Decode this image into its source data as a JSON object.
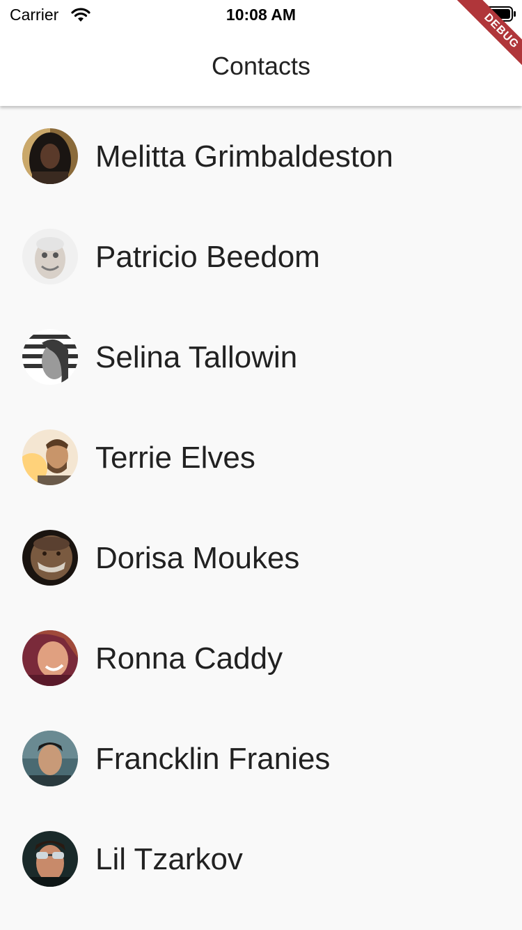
{
  "status_bar": {
    "carrier": "Carrier",
    "time": "10:08 AM",
    "wifi_icon": "wifi-icon",
    "battery_icon": "battery-icon"
  },
  "app_bar": {
    "title": "Contacts"
  },
  "debug_banner": {
    "label": "DEBUG",
    "color": "#b0363a"
  },
  "contacts": [
    {
      "name": "Melitta Grimbaldeston",
      "avatar": "avatar-photo"
    },
    {
      "name": "Patricio Beedom",
      "avatar": "avatar-photo"
    },
    {
      "name": "Selina Tallowin",
      "avatar": "avatar-photo"
    },
    {
      "name": "Terrie Elves",
      "avatar": "avatar-photo"
    },
    {
      "name": "Dorisa Moukes",
      "avatar": "avatar-photo"
    },
    {
      "name": "Ronna Caddy",
      "avatar": "avatar-photo"
    },
    {
      "name": "Francklin Franies",
      "avatar": "avatar-photo"
    },
    {
      "name": "Lil Tzarkov",
      "avatar": "avatar-photo"
    }
  ],
  "colors": {
    "background": "#f9f9f9",
    "app_bar": "#ffffff",
    "text": "#212121"
  }
}
